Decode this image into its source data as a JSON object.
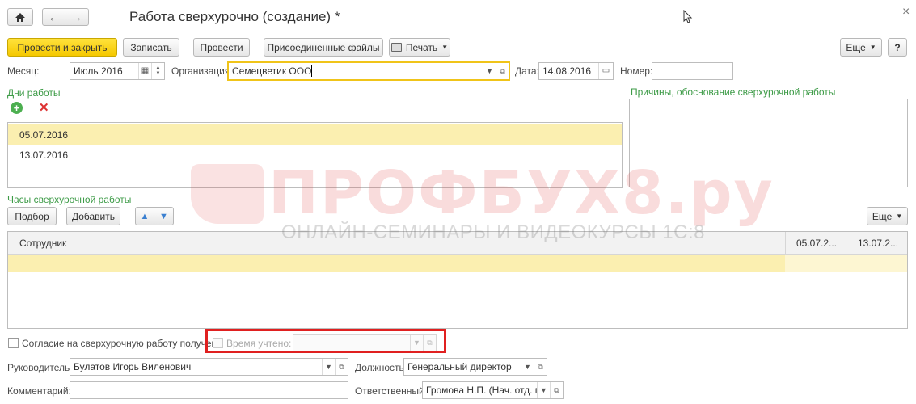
{
  "window": {
    "title": "Работа сверхурочно (создание) *",
    "close_symbol": "×"
  },
  "toolbar": {
    "post_close": "Провести и закрыть",
    "save": "Записать",
    "post": "Провести",
    "attached_files": "Присоединенные файлы",
    "print": "Печать",
    "more": "Еще",
    "help": "?"
  },
  "header": {
    "month_label": "Месяц:",
    "month_value": "Июль 2016",
    "org_label": "Организация:",
    "org_value": "Семецветик ООО",
    "date_label": "Дата:",
    "date_value": "14.08.2016",
    "number_label": "Номер:",
    "number_value": ""
  },
  "work_days": {
    "title": "Дни работы",
    "rows": [
      "05.07.2016",
      "13.07.2016"
    ]
  },
  "reasons": {
    "title": "Причины, обоснование сверхурочной работы"
  },
  "overtime_hours": {
    "title": "Часы сверхурочной работы",
    "select_button": "Подбор",
    "add_button": "Добавить",
    "more": "Еще",
    "columns": [
      "Сотрудник",
      "05.07.2...",
      "13.07.2..."
    ]
  },
  "watermark": {
    "main": "ПРОФБУХ8.ру",
    "sub": "ОНЛАЙН-СЕМИНАРЫ И ВИДЕОКУРСЫ 1С:8"
  },
  "footer": {
    "consent_label": "Согласие на сверхурочную работу получено",
    "time_counted_label": "Время учтено:",
    "manager_label": "Руководитель:",
    "manager_value": "Булатов Игорь Виленович",
    "position_label": "Должность:",
    "position_value": "Генеральный директор",
    "comment_label": "Комментарий:",
    "comment_value": "",
    "responsible_label": "Ответственный:",
    "responsible_value": "Громова Н.П. (Нач. отд. по"
  },
  "colors": {
    "accent_yellow": "#f5c800",
    "selected_row": "#fbefb0",
    "group_title_green": "#3d9b47",
    "highlight_red": "#e02020"
  }
}
